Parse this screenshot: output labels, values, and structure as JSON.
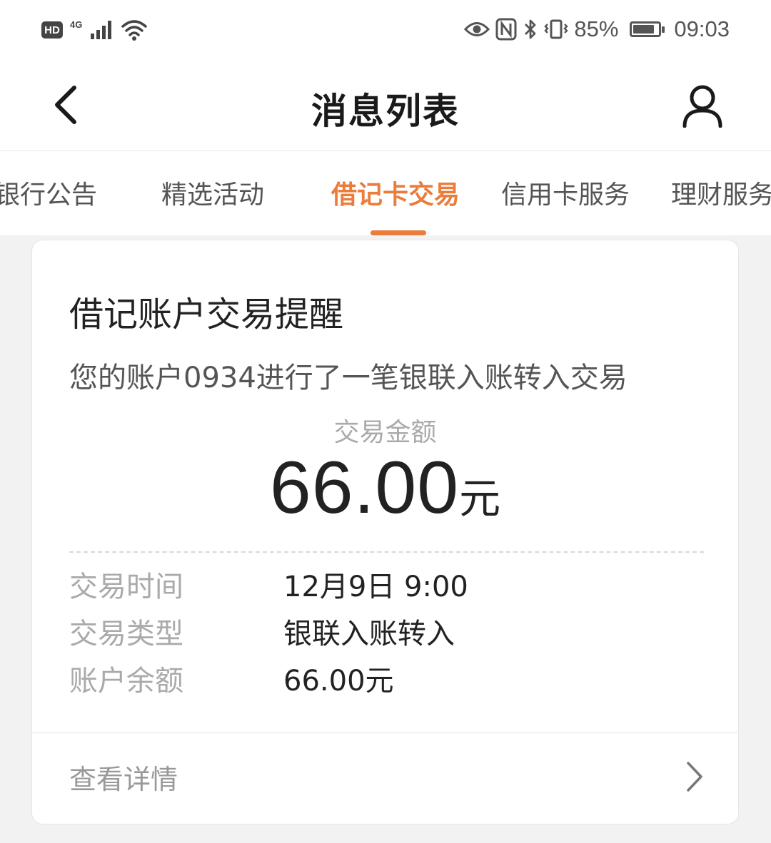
{
  "status_bar": {
    "hd": "HD",
    "network": "4G",
    "battery_percent": "85%",
    "battery_level": 0.85,
    "time": "09:03"
  },
  "nav": {
    "title": "消息列表"
  },
  "tabs": [
    {
      "label": "银行公告",
      "active": false
    },
    {
      "label": "精选活动",
      "active": false
    },
    {
      "label": "借记卡交易",
      "active": true
    },
    {
      "label": "信用卡服务",
      "active": false
    },
    {
      "label": "理财服务",
      "active": false
    }
  ],
  "card": {
    "title": "借记账户交易提醒",
    "description": "您的账户0934进行了一笔银联入账转入交易",
    "amount_label": "交易金额",
    "amount_value": "66.00",
    "amount_unit": "元",
    "details": [
      {
        "label": "交易时间",
        "value": "12月9日 9:00"
      },
      {
        "label": "交易类型",
        "value": "银联入账转入"
      },
      {
        "label": "账户余额",
        "value": "66.00元"
      }
    ],
    "view_detail_label": "查看详情"
  },
  "colors": {
    "accent": "#ea7d3c"
  }
}
